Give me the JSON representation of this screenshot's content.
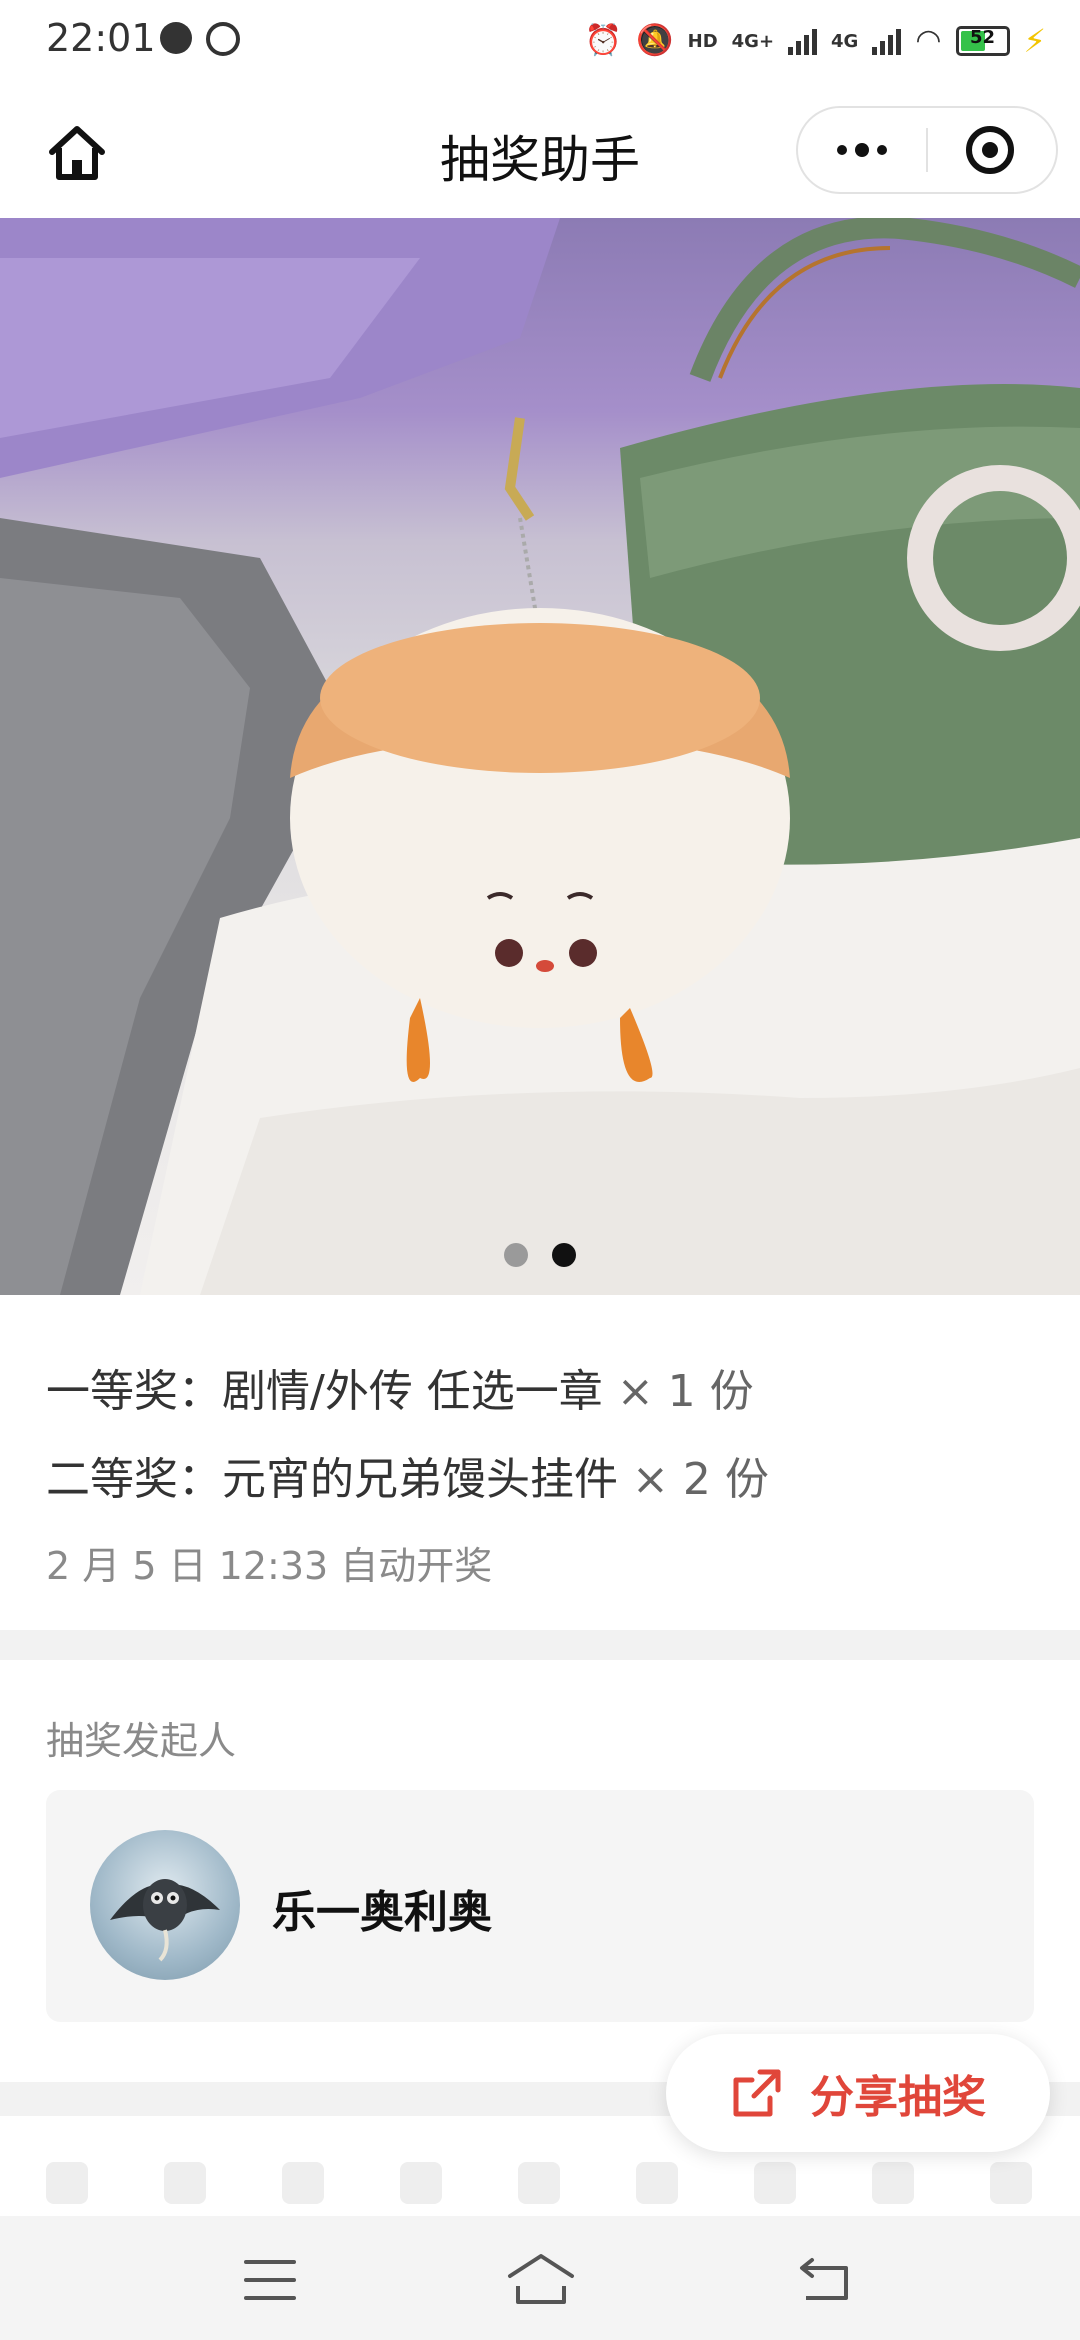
{
  "status_bar": {
    "time": "22:01",
    "net1": "4G+",
    "net2": "4G",
    "hd_badge": "HD",
    "battery_level": "52"
  },
  "nav": {
    "title": "抽奖助手"
  },
  "carousel": {
    "total": 2,
    "active_index": 1
  },
  "prizes": [
    {
      "label": "一等奖：剧情/外传 任选一章",
      "qty": "× 1 份"
    },
    {
      "label": "二等奖：元宵的兄弟馒头挂件",
      "qty": "× 2 份"
    }
  ],
  "draw_time": "2 月 5 日 12:33 自动开奖",
  "initiator": {
    "section_label": "抽奖发起人",
    "name": "乐一奥利奥"
  },
  "share": {
    "label": "分享抽奖"
  },
  "colors": {
    "accent": "#e0463a",
    "battery": "#35c24a",
    "charging": "#f2c400"
  }
}
